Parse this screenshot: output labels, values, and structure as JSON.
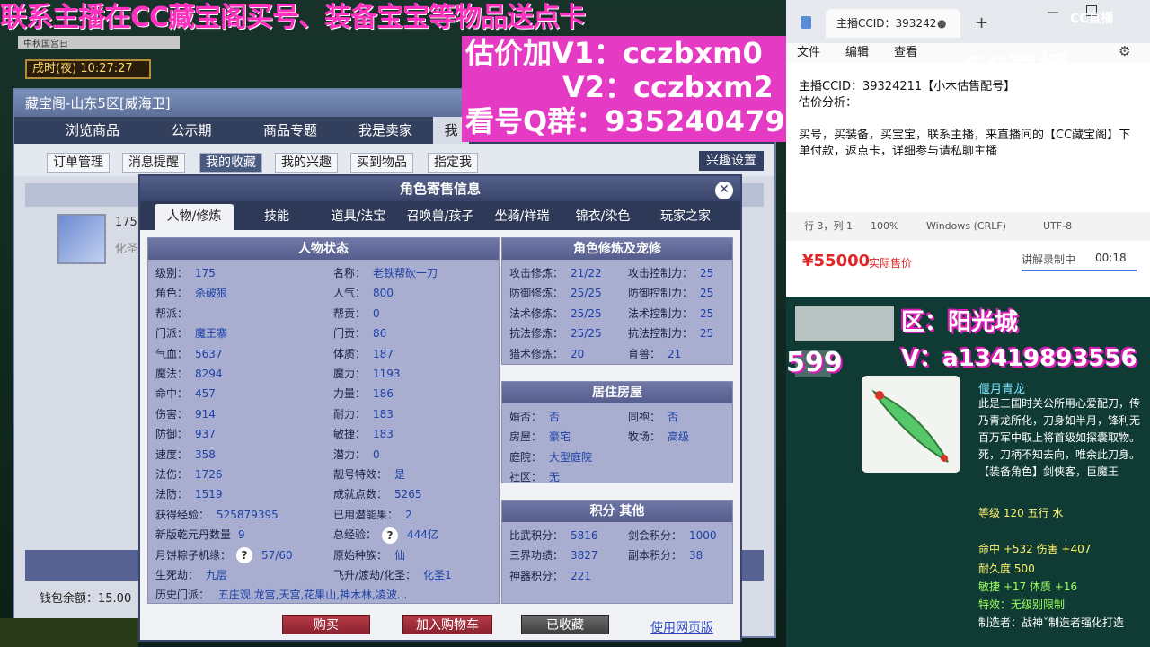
{
  "banner": {
    "line1": "联系主播在CC藏宝阁买号、装备宝宝等物品送点卡",
    "pink_lines": [
      "估价加V1：cczbxm0",
      "V2：cczbxm2",
      "看号Q群：935240479"
    ]
  },
  "game": {
    "browser_tab": "中秋国宫日",
    "clock": "戌时(夜)  10:27:27"
  },
  "cbg": {
    "title": "藏宝阁-山东5区[威海卫]",
    "nav": [
      "浏览商品",
      "公示期",
      "商品专题",
      "我是卖家",
      "我"
    ],
    "subnav": [
      "订单管理",
      "消息提醒",
      "我的收藏",
      "我的兴趣",
      "买到物品",
      "指定我"
    ],
    "interest_btn": "兴趣设置",
    "list_level": "175",
    "list_sub": "化圣",
    "wallet": "钱包余额：15.00"
  },
  "modal": {
    "title": "角色寄售信息",
    "close": "✕",
    "tabs": [
      "人物/修炼",
      "技能",
      "道具/法宝",
      "召唤兽/孩子",
      "坐骑/祥瑞",
      "锦衣/染色",
      "玩家之家"
    ],
    "status_head": "人物状态",
    "left_col": [
      [
        "级别：",
        "175"
      ],
      [
        "角色：",
        "杀破狼"
      ],
      [
        "帮派：",
        ""
      ],
      [
        "门派：",
        "魔王寨"
      ],
      [
        "气血：",
        "5637"
      ],
      [
        "魔法：",
        "8294"
      ],
      [
        "命中：",
        "457"
      ],
      [
        "伤害：",
        "914"
      ],
      [
        "防御：",
        "937"
      ],
      [
        "速度：",
        "358"
      ],
      [
        "法伤：",
        "1726"
      ],
      [
        "法防：",
        "1519"
      ],
      [
        "获得经验：",
        "525879395"
      ],
      [
        "新版乾元丹数量",
        "9"
      ],
      [
        "月饼粽子机缘：",
        "57/60"
      ],
      [
        "生死劫：",
        "九层"
      ]
    ],
    "mid_col": [
      [
        "名称：",
        "老铁帮砍一刀"
      ],
      [
        "人气：",
        "800"
      ],
      [
        "帮贡：",
        "0"
      ],
      [
        "门贡：",
        "86"
      ],
      [
        "体质：",
        "187"
      ],
      [
        "魔力：",
        "1193"
      ],
      [
        "力量：",
        "186"
      ],
      [
        "耐力：",
        "183"
      ],
      [
        "敏捷：",
        "183"
      ],
      [
        "潜力：",
        "0"
      ],
      [
        "靓号特效：",
        "是"
      ],
      [
        "成就点数：",
        "5265"
      ],
      [
        "已用潜能果：",
        "2"
      ],
      [
        "总经验：",
        "444亿"
      ],
      [
        "原始种族：",
        "仙"
      ],
      [
        "飞升/渡劫/化圣：",
        "化圣1"
      ]
    ],
    "history_label": "历史门派：",
    "history_value": "五庄观,龙宫,天宫,花果山,神木林,凌波...",
    "cultivation_head": "角色修炼及宠修",
    "cultivation": [
      [
        "攻击修炼：",
        "21/22",
        "攻击控制力：",
        "25"
      ],
      [
        "防御修炼：",
        "25/25",
        "防御控制力：",
        "25"
      ],
      [
        "法术修炼：",
        "25/25",
        "法术控制力：",
        "25"
      ],
      [
        "抗法修炼：",
        "25/25",
        "抗法控制力：",
        "25"
      ],
      [
        "猎术修炼：",
        "20",
        "育兽：",
        "21"
      ]
    ],
    "house_head": "居住房屋",
    "house": [
      [
        "婚否：",
        "否",
        "同袍：",
        "否"
      ],
      [
        "房屋：",
        "豪宅",
        "牧场：",
        "高级"
      ],
      [
        "庭院：",
        "大型庭院",
        "",
        ""
      ],
      [
        "社区：",
        "无",
        "",
        ""
      ]
    ],
    "score_head": "积分 其他",
    "score": [
      [
        "比武积分：",
        "5816",
        "剑会积分：",
        "1000"
      ],
      [
        "三界功绩：",
        "3827",
        "副本积分：",
        "38"
      ],
      [
        "神器积分：",
        "221",
        "",
        ""
      ]
    ],
    "buttons": {
      "buy": "购买",
      "cart": "加入购物车",
      "fav": "已收藏",
      "web": "使用网页版"
    },
    "question": "?"
  },
  "notepad": {
    "tab_title": "主播CCID：393242",
    "menu": [
      "文件",
      "编辑",
      "查看"
    ],
    "body_line1": "主播CCID：39324211【小木估售配号】",
    "body_line2": "估价分析：",
    "body_line3": "买号，买装备，买宝宝，联系主播，来直播间的【CC藏宝阁】下单付款，返点卡，详细参与请私聊主播",
    "status": [
      "行 3，列 1",
      "100%",
      "Windows (CRLF)",
      "UTF-8"
    ],
    "logo": "CC直播"
  },
  "price_strip": {
    "price": "¥55000",
    "price_label": "实际售价",
    "rec_label": "讲解录制中",
    "rec_time": "00:18"
  },
  "item": {
    "server": "区：阳光城",
    "vx": "V：a13419893556",
    "big_number": "599",
    "name": "偃月青龙",
    "desc": "此是三国时关公所用心爱配刀，传乃青龙所化，刀身如半月，锋利无百万军中取上将首级如探囊取物。死，刀柄不知去向，唯余此刀身。",
    "equip_role": "【装备角色】剑侠客，巨魔王",
    "level": "等级 120  五行 水",
    "hit": "命中 +532  伤害 +407",
    "durability": "耐久度 500",
    "agility": "敏捷 +17  体质 +16",
    "effect": "特效：无级别限制",
    "maker": "制造者：战神ˇ制造者强化打造"
  },
  "colors": {
    "accent_pink": "#e53ac3",
    "modal_header": "#38446a",
    "price_red": "#e02525"
  }
}
